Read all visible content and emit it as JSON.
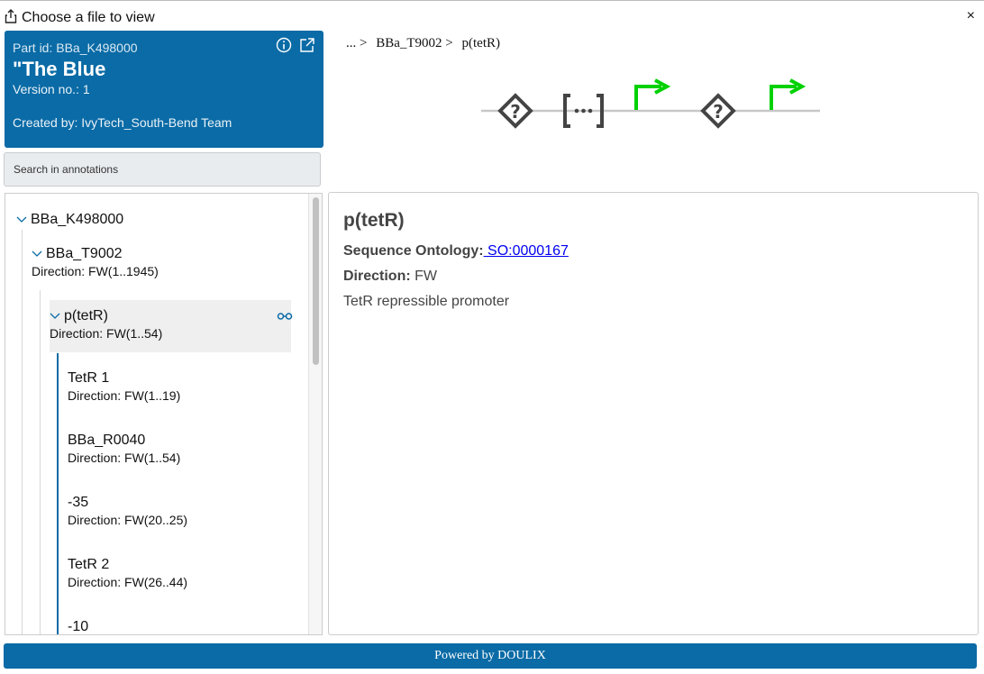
{
  "window": {
    "title": "Choose a file to view",
    "close": "×"
  },
  "part": {
    "id_line": "Part id: BBa_K498000",
    "name": "\"The Blue",
    "version_line": "Version no.: 1",
    "created_line": "Created by: IvyTech_South-Bend Team",
    "icons": [
      "info-icon",
      "external-link-icon"
    ]
  },
  "search": {
    "placeholder": "Search in annotations",
    "value": ""
  },
  "tree": {
    "root": {
      "name": "BBa_K498000"
    },
    "child": {
      "name": "BBa_T9002",
      "direction": "Direction: FW(1..1945)"
    },
    "selected": {
      "name": "p(tetR)",
      "direction": "Direction: FW(1..54)"
    },
    "subitems": [
      {
        "name": "TetR 1",
        "direction": "Direction: FW(1..19)"
      },
      {
        "name": "BBa_R0040",
        "direction": "Direction: FW(1..54)"
      },
      {
        "name": "-35",
        "direction": "Direction: FW(20..25)"
      },
      {
        "name": "TetR 2",
        "direction": "Direction: FW(26..44)"
      },
      {
        "name": "-10",
        "direction": ""
      }
    ]
  },
  "breadcrumb": {
    "items": [
      "... >",
      "BBa_T9002 >",
      "p(tetR)"
    ]
  },
  "sbol_glyphs": [
    "unspecified-icon",
    "composite-icon",
    "promoter-icon",
    "unspecified-icon",
    "promoter-icon"
  ],
  "detail": {
    "title": "p(tetR)",
    "ontology_label": "Sequence Ontology:",
    "ontology_value": " SO:0000167",
    "direction_label": "Direction:",
    "direction_value": " FW",
    "description": "TetR repressible promoter"
  },
  "footer": {
    "text": "Powered by DOULIX"
  },
  "colors": {
    "brand": "#0a6ba6",
    "promoter": "#00d100",
    "glyph": "#444444"
  }
}
